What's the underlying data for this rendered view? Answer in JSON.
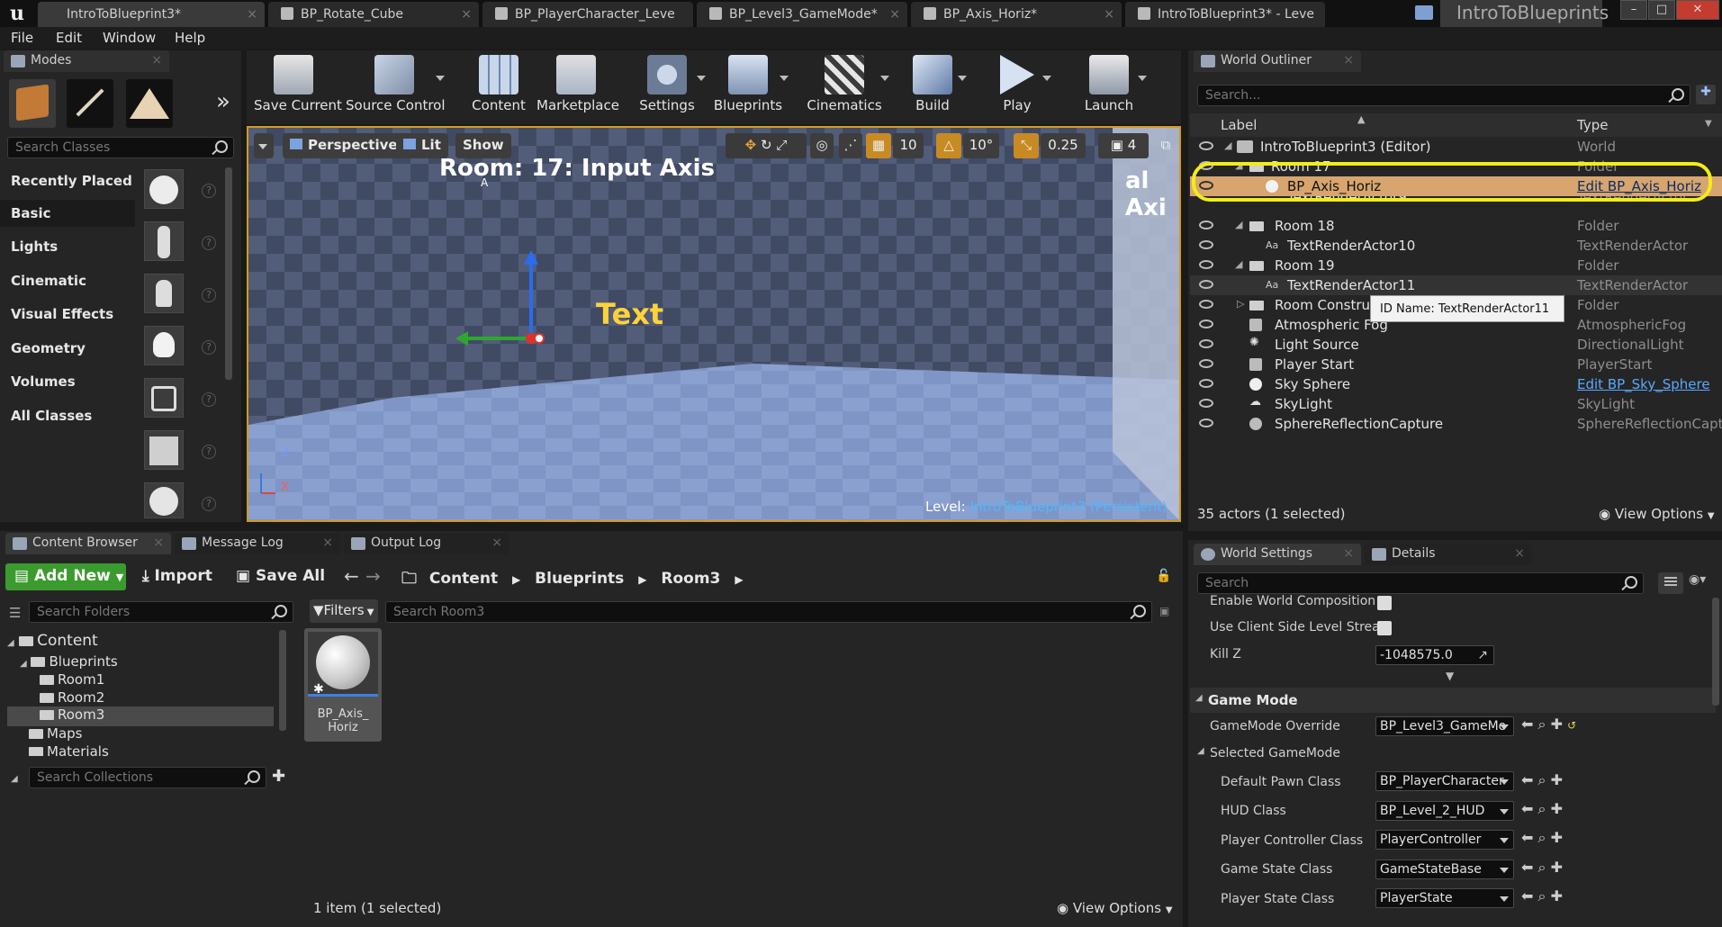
{
  "titlebar": {
    "logo": "u",
    "tabs": [
      "IntroToBlueprint3*",
      "BP_Rotate_Cube",
      "BP_PlayerCharacter_Leve",
      "BP_Level3_GameMode*",
      "BP_Axis_Horiz*",
      "IntroToBlueprint3* - Leve"
    ],
    "app_title": "IntroToBlueprints",
    "controls": [
      "–",
      "□",
      "✕"
    ]
  },
  "menubar": {
    "items": [
      "File",
      "Edit",
      "Window",
      "Help"
    ]
  },
  "modes": {
    "tab_label": "Modes",
    "search_placeholder": "Search Classes",
    "categories": [
      "Recently Placed",
      "Basic",
      "Lights",
      "Cinematic",
      "Visual Effects",
      "Geometry",
      "Volumes",
      "All Classes"
    ],
    "selected_category": "Basic"
  },
  "toolbar": {
    "buttons": [
      "Save Current",
      "Source Control",
      "Content",
      "Marketplace",
      "Settings",
      "Blueprints",
      "Cinematics",
      "Build",
      "Play",
      "Launch"
    ],
    "expand_glyph": "»"
  },
  "viewport": {
    "perspective": "Perspective",
    "lit": "Lit",
    "show": "Show",
    "grid_snap": "10",
    "rot_snap": "10°",
    "scale_snap": "0.25",
    "camera_speed": "4",
    "room_title": "Room: 17: Input Axis",
    "side_text": "al Axi",
    "small_a": "A",
    "text_actor": "Text",
    "axis_z": "Z",
    "axis_x": "X",
    "level_prefix": "Level:",
    "level_name": "IntroToBlueprint3 (Persistent)"
  },
  "outliner": {
    "tab_label": "World Outliner",
    "search_placeholder": "Search...",
    "col_label": "Label",
    "col_type": "Type",
    "rows": [
      {
        "label": "IntroToBlueprint3 (Editor)",
        "type": "World"
      },
      {
        "label": "Room 17",
        "type": "Folder"
      },
      {
        "label": "BP_Axis_Horiz",
        "type": "Edit BP_Axis_Horiz"
      },
      {
        "label": "TextRenderActor9",
        "type": "TextRenderActor"
      },
      {
        "label": "Room 18",
        "type": "Folder"
      },
      {
        "label": "TextRenderActor10",
        "type": "TextRenderActor"
      },
      {
        "label": "Room 19",
        "type": "Folder"
      },
      {
        "label": "TextRenderActor11",
        "type": "TextRenderActor"
      },
      {
        "label": "Room Construc",
        "type": "Folder"
      },
      {
        "label": "Atmospheric Fog",
        "type": "AtmosphericFog"
      },
      {
        "label": "Light Source",
        "type": "DirectionalLight"
      },
      {
        "label": "Player Start",
        "type": "PlayerStart"
      },
      {
        "label": "Sky Sphere",
        "type": "Edit BP_Sky_Sphere"
      },
      {
        "label": "SkyLight",
        "type": "SkyLight"
      },
      {
        "label": "SphereReflectionCapture",
        "type": "SphereReflectionCaptu"
      }
    ],
    "tooltip": "ID Name: TextRenderActor11",
    "status": "35 actors (1 selected)",
    "view_options": "View Options"
  },
  "details": {
    "tab_world_settings": "World Settings",
    "tab_details": "Details",
    "search_placeholder": "Search",
    "props_top": [
      {
        "label": "Enable World Composition"
      },
      {
        "label": "Use Client Side Level Strea"
      },
      {
        "label": "Kill Z",
        "value": "-1048575.0"
      }
    ],
    "section_game_mode": "Game Mode",
    "gamemode_override_label": "GameMode Override",
    "gamemode_override_value": "BP_Level3_GameMo",
    "selected_gamemode": "Selected GameMode",
    "class_rows": [
      {
        "label": "Default Pawn Class",
        "value": "BP_PlayerCharacter"
      },
      {
        "label": "HUD Class",
        "value": "BP_Level_2_HUD"
      },
      {
        "label": "Player Controller Class",
        "value": "PlayerController"
      },
      {
        "label": "Game State Class",
        "value": "GameStateBase"
      },
      {
        "label": "Player State Class",
        "value": "PlayerState"
      }
    ]
  },
  "content_browser": {
    "tabs": [
      "Content Browser",
      "Message Log",
      "Output Log"
    ],
    "add_new": "Add New",
    "import": "Import",
    "save_all": "Save All",
    "path": [
      "Content",
      "Blueprints",
      "Room3"
    ],
    "search_folders": "Search Folders",
    "filters": "Filters",
    "search_assets": "Search Room3",
    "tree": [
      "Content",
      "Blueprints",
      "Room1",
      "Room2",
      "Room3",
      "Maps",
      "Materials"
    ],
    "search_collections": "Search Collections",
    "asset_name": "BP_Axis_\nHoriz",
    "status": "1 item (1 selected)",
    "view_options": "View Options"
  },
  "colors": {
    "highlight_ring": "#f2ec1a",
    "selection_row": "#d7a56d",
    "link": "#5aa9ff",
    "add_new_green": "#3c9b2f",
    "viewport_border": "#d49a1c"
  }
}
